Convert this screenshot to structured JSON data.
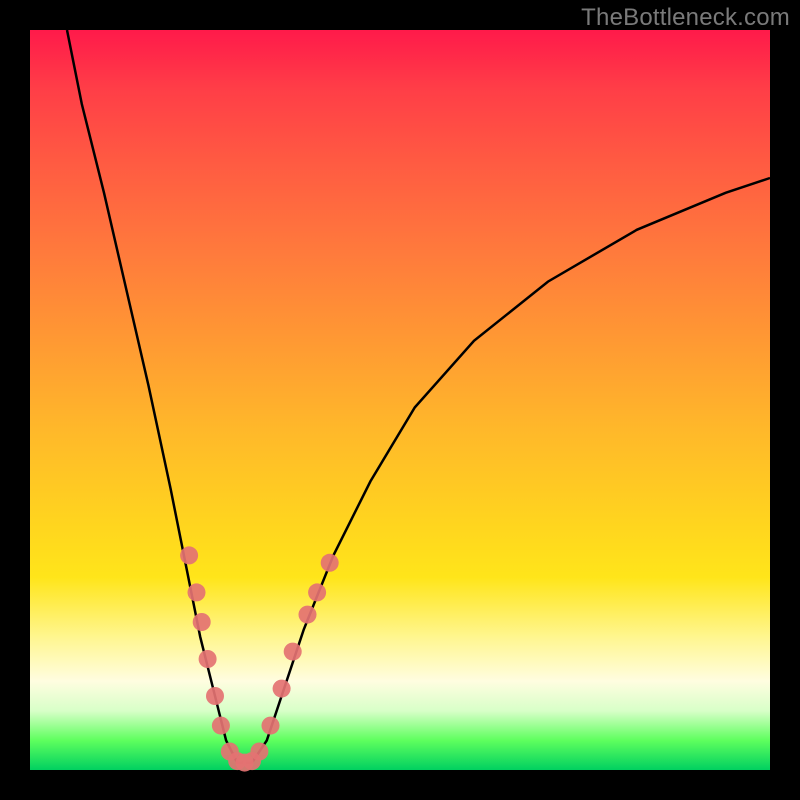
{
  "watermark": "TheBottleneck.com",
  "colors": {
    "frame": "#000000",
    "curve": "#000000",
    "dot": "#e47272",
    "gradient_stops": [
      "#ff1a4a",
      "#ff3e47",
      "#ff5b42",
      "#ff7a3c",
      "#ff9933",
      "#ffb82a",
      "#ffd31f",
      "#ffe51a",
      "#fff68f",
      "#fffde0",
      "#d8ffc8",
      "#5eff5e",
      "#00d060"
    ]
  },
  "chart_data": {
    "type": "line",
    "title": "",
    "xlabel": "",
    "ylabel": "",
    "xlim": [
      0,
      100
    ],
    "ylim": [
      0,
      100
    ],
    "curve": [
      {
        "x": 5,
        "y": 100
      },
      {
        "x": 7,
        "y": 90
      },
      {
        "x": 10,
        "y": 78
      },
      {
        "x": 13,
        "y": 65
      },
      {
        "x": 16,
        "y": 52
      },
      {
        "x": 19,
        "y": 38
      },
      {
        "x": 21,
        "y": 28
      },
      {
        "x": 23,
        "y": 18
      },
      {
        "x": 25,
        "y": 10
      },
      {
        "x": 26.5,
        "y": 4
      },
      {
        "x": 28,
        "y": 1
      },
      {
        "x": 30,
        "y": 1
      },
      {
        "x": 32,
        "y": 4
      },
      {
        "x": 34,
        "y": 10
      },
      {
        "x": 37,
        "y": 19
      },
      {
        "x": 41,
        "y": 29
      },
      {
        "x": 46,
        "y": 39
      },
      {
        "x": 52,
        "y": 49
      },
      {
        "x": 60,
        "y": 58
      },
      {
        "x": 70,
        "y": 66
      },
      {
        "x": 82,
        "y": 73
      },
      {
        "x": 94,
        "y": 78
      },
      {
        "x": 100,
        "y": 80
      }
    ],
    "scatter": [
      {
        "x": 21.5,
        "y": 29
      },
      {
        "x": 22.5,
        "y": 24
      },
      {
        "x": 23.2,
        "y": 20
      },
      {
        "x": 24,
        "y": 15
      },
      {
        "x": 25,
        "y": 10
      },
      {
        "x": 25.8,
        "y": 6
      },
      {
        "x": 27,
        "y": 2.5
      },
      {
        "x": 28,
        "y": 1.2
      },
      {
        "x": 29,
        "y": 1.0
      },
      {
        "x": 30,
        "y": 1.2
      },
      {
        "x": 31,
        "y": 2.5
      },
      {
        "x": 32.5,
        "y": 6
      },
      {
        "x": 34,
        "y": 11
      },
      {
        "x": 35.5,
        "y": 16
      },
      {
        "x": 37.5,
        "y": 21
      },
      {
        "x": 38.8,
        "y": 24
      },
      {
        "x": 40.5,
        "y": 28
      }
    ],
    "scatter_radius": 9
  }
}
